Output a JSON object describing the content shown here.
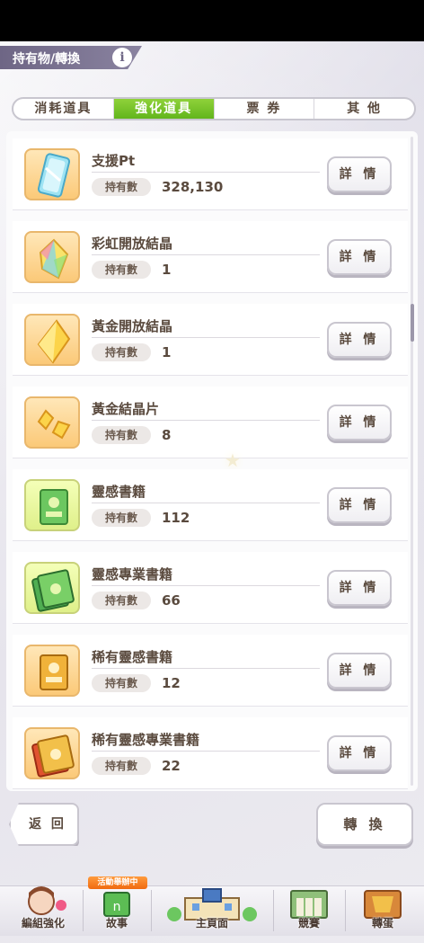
{
  "header": {
    "title": "持有物/轉換",
    "info_icon": "i"
  },
  "tabs": [
    {
      "label": "消耗道具",
      "active": false
    },
    {
      "label": "強化道具",
      "active": true
    },
    {
      "label": "票 券",
      "active": false
    },
    {
      "label": "其 他",
      "active": false
    }
  ],
  "count_label": "持有數",
  "detail_label": "詳 情",
  "items": [
    {
      "name": "支援Pt",
      "count": "328,130",
      "icon": "support-pt-card-icon"
    },
    {
      "name": "彩虹開放結晶",
      "count": "1",
      "icon": "rainbow-crystal-icon"
    },
    {
      "name": "黃金開放結晶",
      "count": "1",
      "icon": "gold-crystal-icon"
    },
    {
      "name": "黃金結晶片",
      "count": "8",
      "icon": "gold-crystal-shard-icon"
    },
    {
      "name": "靈感書籍",
      "count": "112",
      "icon": "inspiration-book-icon"
    },
    {
      "name": "靈感專業書籍",
      "count": "66",
      "icon": "inspiration-pro-book-icon"
    },
    {
      "name": "稀有靈感書籍",
      "count": "12",
      "icon": "rare-inspiration-book-icon"
    },
    {
      "name": "稀有靈感專業書籍",
      "count": "22",
      "icon": "rare-inspiration-pro-book-icon"
    }
  ],
  "footer": {
    "back_label": "返 回",
    "convert_label": "轉 換"
  },
  "nav": {
    "event_badge": "活動舉辦中",
    "items": [
      {
        "label": "編組強化",
        "icon": "character-portrait-icon"
      },
      {
        "label": "故事",
        "icon": "story-book-icon"
      },
      {
        "label": "主頁面",
        "icon": "home-building-icon"
      },
      {
        "label": "競賽",
        "icon": "race-gate-icon"
      },
      {
        "label": "轉蛋",
        "icon": "gacha-icon"
      }
    ]
  },
  "colors": {
    "tab_active": "#62b51c",
    "title_bar": "#6e6685",
    "badge": "#f06a10"
  }
}
